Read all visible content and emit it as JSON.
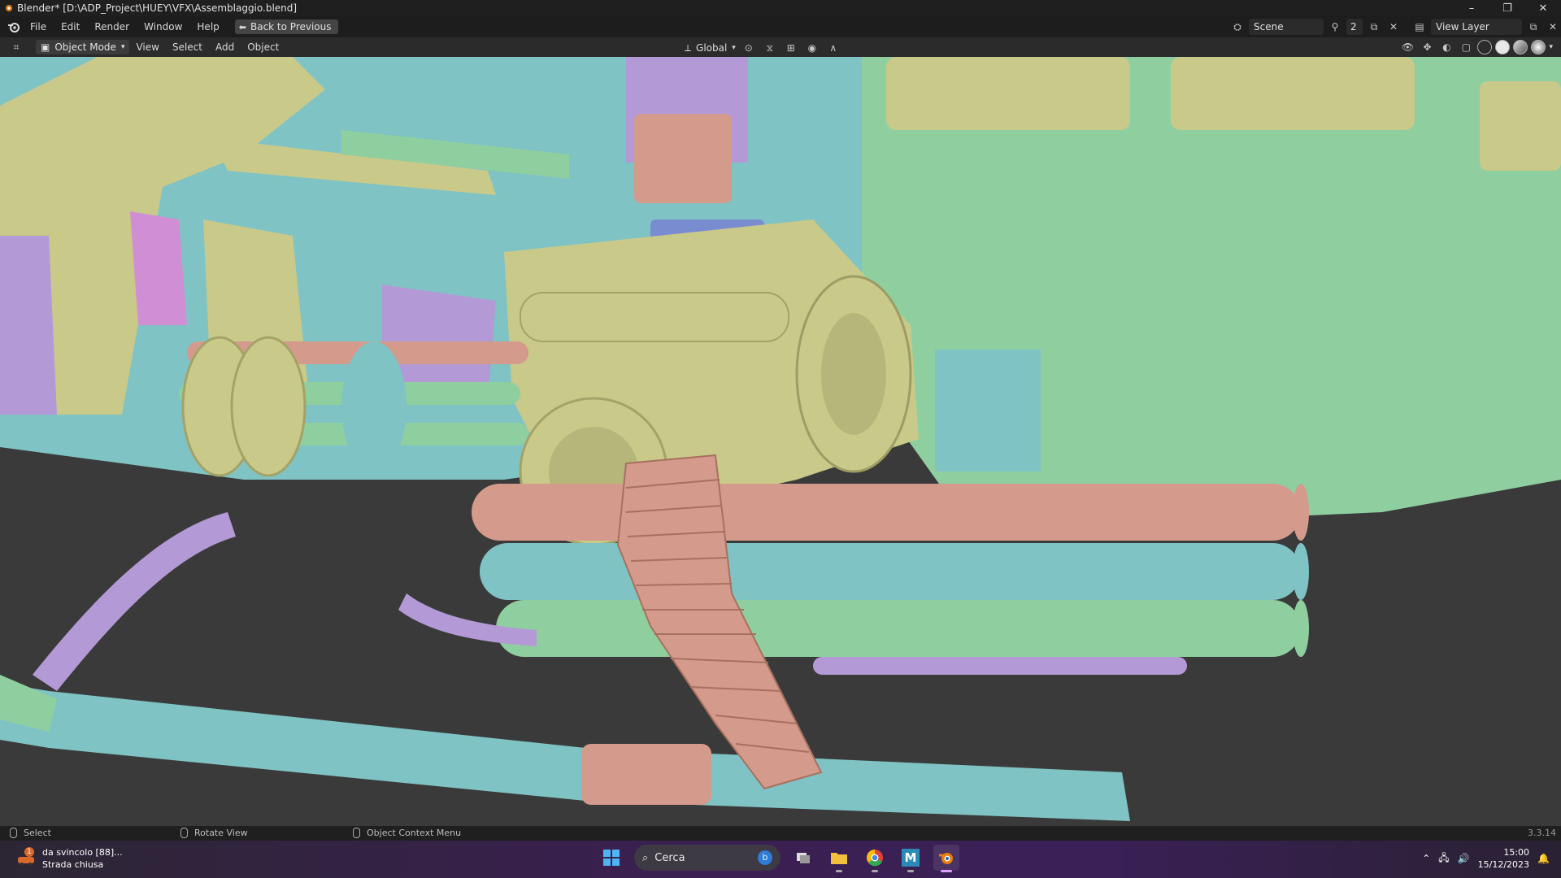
{
  "titlebar": {
    "title": "Blender* [D:\\ADP_Project\\HUEY\\VFX\\Assemblaggio.blend]",
    "minimize": "–",
    "maximize": "❐",
    "close": "✕"
  },
  "menubar": {
    "items": [
      "File",
      "Edit",
      "Render",
      "Window",
      "Help"
    ],
    "back_button": "Back to Previous",
    "scene_label": "Scene",
    "scene_users": "2",
    "view_layer_label": "View Layer"
  },
  "viewport_header": {
    "mode": "Object Mode",
    "menus": [
      "View",
      "Select",
      "Add",
      "Object"
    ],
    "transform_orientation": "Global"
  },
  "statusbar": {
    "select": "Select",
    "rotate": "Rotate View",
    "context_menu": "Object Context Menu",
    "version": "3.3.14"
  },
  "taskbar": {
    "notification_title": "da svincolo [88]...",
    "notification_subtitle": "Strada chiusa",
    "notification_badge": "1",
    "search_placeholder": "Cerca",
    "time": "15:00",
    "date": "15/12/2023"
  },
  "colors": {
    "olive": "#c9c98a",
    "green": "#8fcf9f",
    "teal": "#7fc3c4",
    "salmon": "#d49a8c",
    "purple": "#b39ad6",
    "pink": "#d08fd4",
    "background": "#3a3a3a"
  }
}
